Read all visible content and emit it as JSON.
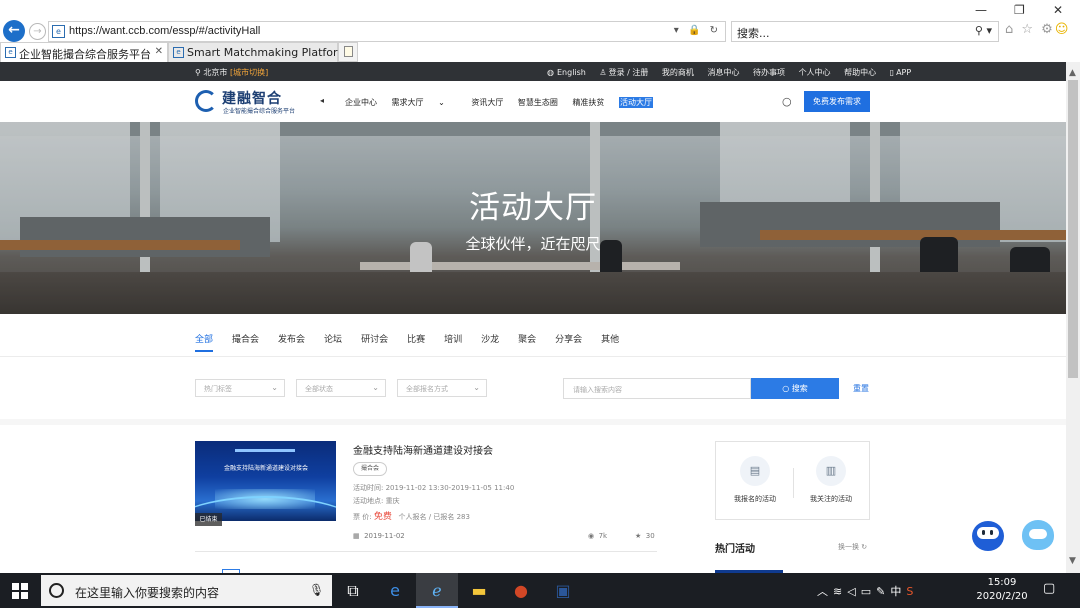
{
  "browser": {
    "url": "https://want.ccb.com/essp/#/activityHall",
    "search_placeholder": "搜索...",
    "addr_tools": "▾ 🔒 ↻",
    "search_icon": "⚲ ▾",
    "toolbar_icons": "⌂ ☆ ⚙",
    "smiley": "☺",
    "window_controls": {
      "minimize": "—",
      "maximize": "❐",
      "close": "✕"
    },
    "tabs": [
      {
        "label": "企业智能撮合综合服务平台",
        "active": true,
        "close": "✕"
      },
      {
        "label": "Smart Matchmaking Platform",
        "active": false
      }
    ]
  },
  "topbar": {
    "city": "北京市",
    "city_switch": "[城市切换]",
    "links": [
      "English",
      "登录 / 注册",
      "我的商机",
      "消息中心",
      "待办事项",
      "个人中心",
      "帮助中心",
      "APP"
    ]
  },
  "header": {
    "logo_title": "建融智合",
    "logo_subtitle": "企业智能撮合综合服务平台",
    "nav": [
      "企业中心",
      "需求大厅",
      "资讯大厅",
      "智慧生态圈",
      "精准扶贫",
      "活动大厅"
    ],
    "nav_active_index": 5,
    "publish_button": "免费发布需求"
  },
  "banner": {
    "title": "活动大厅",
    "subtitle": "全球伙伴，近在咫尺"
  },
  "categories": [
    "全部",
    "撮合会",
    "发布会",
    "论坛",
    "研讨会",
    "比赛",
    "培训",
    "沙龙",
    "聚会",
    "分享会",
    "其他"
  ],
  "filters": {
    "hot_tags": "热门标签",
    "all_status": "全部状态",
    "all_signup": "全部报名方式",
    "keyword_placeholder": "请输入搜索内容",
    "search_button": "搜索",
    "reset": "重置"
  },
  "activity": {
    "title": "金融支持陆海新通道建设对接会",
    "tag": "撮合会",
    "time_label": "活动时间:",
    "time_value": "2019-11-02 13:30-2019-11-05 11:40",
    "place_label": "活动地点:",
    "place_value": "重庆",
    "price_label": "票 价:",
    "price_value": "免费",
    "signup_info": "个人报名 / 已报名 283",
    "date": "2019-11-02",
    "views": "7k",
    "stars": "30",
    "status_badge": "已结束",
    "image_caption": "金融支持陆海新通道建设对接会"
  },
  "sidebar": {
    "my_signed": "我报名的活动",
    "my_followed": "我关注的活动",
    "hot_title": "热门活动",
    "hot_more": "换一换"
  },
  "taskbar": {
    "search_text": "在这里输入你要搜索的内容",
    "time": "15:09",
    "date": "2020/2/20",
    "ime": "中"
  }
}
